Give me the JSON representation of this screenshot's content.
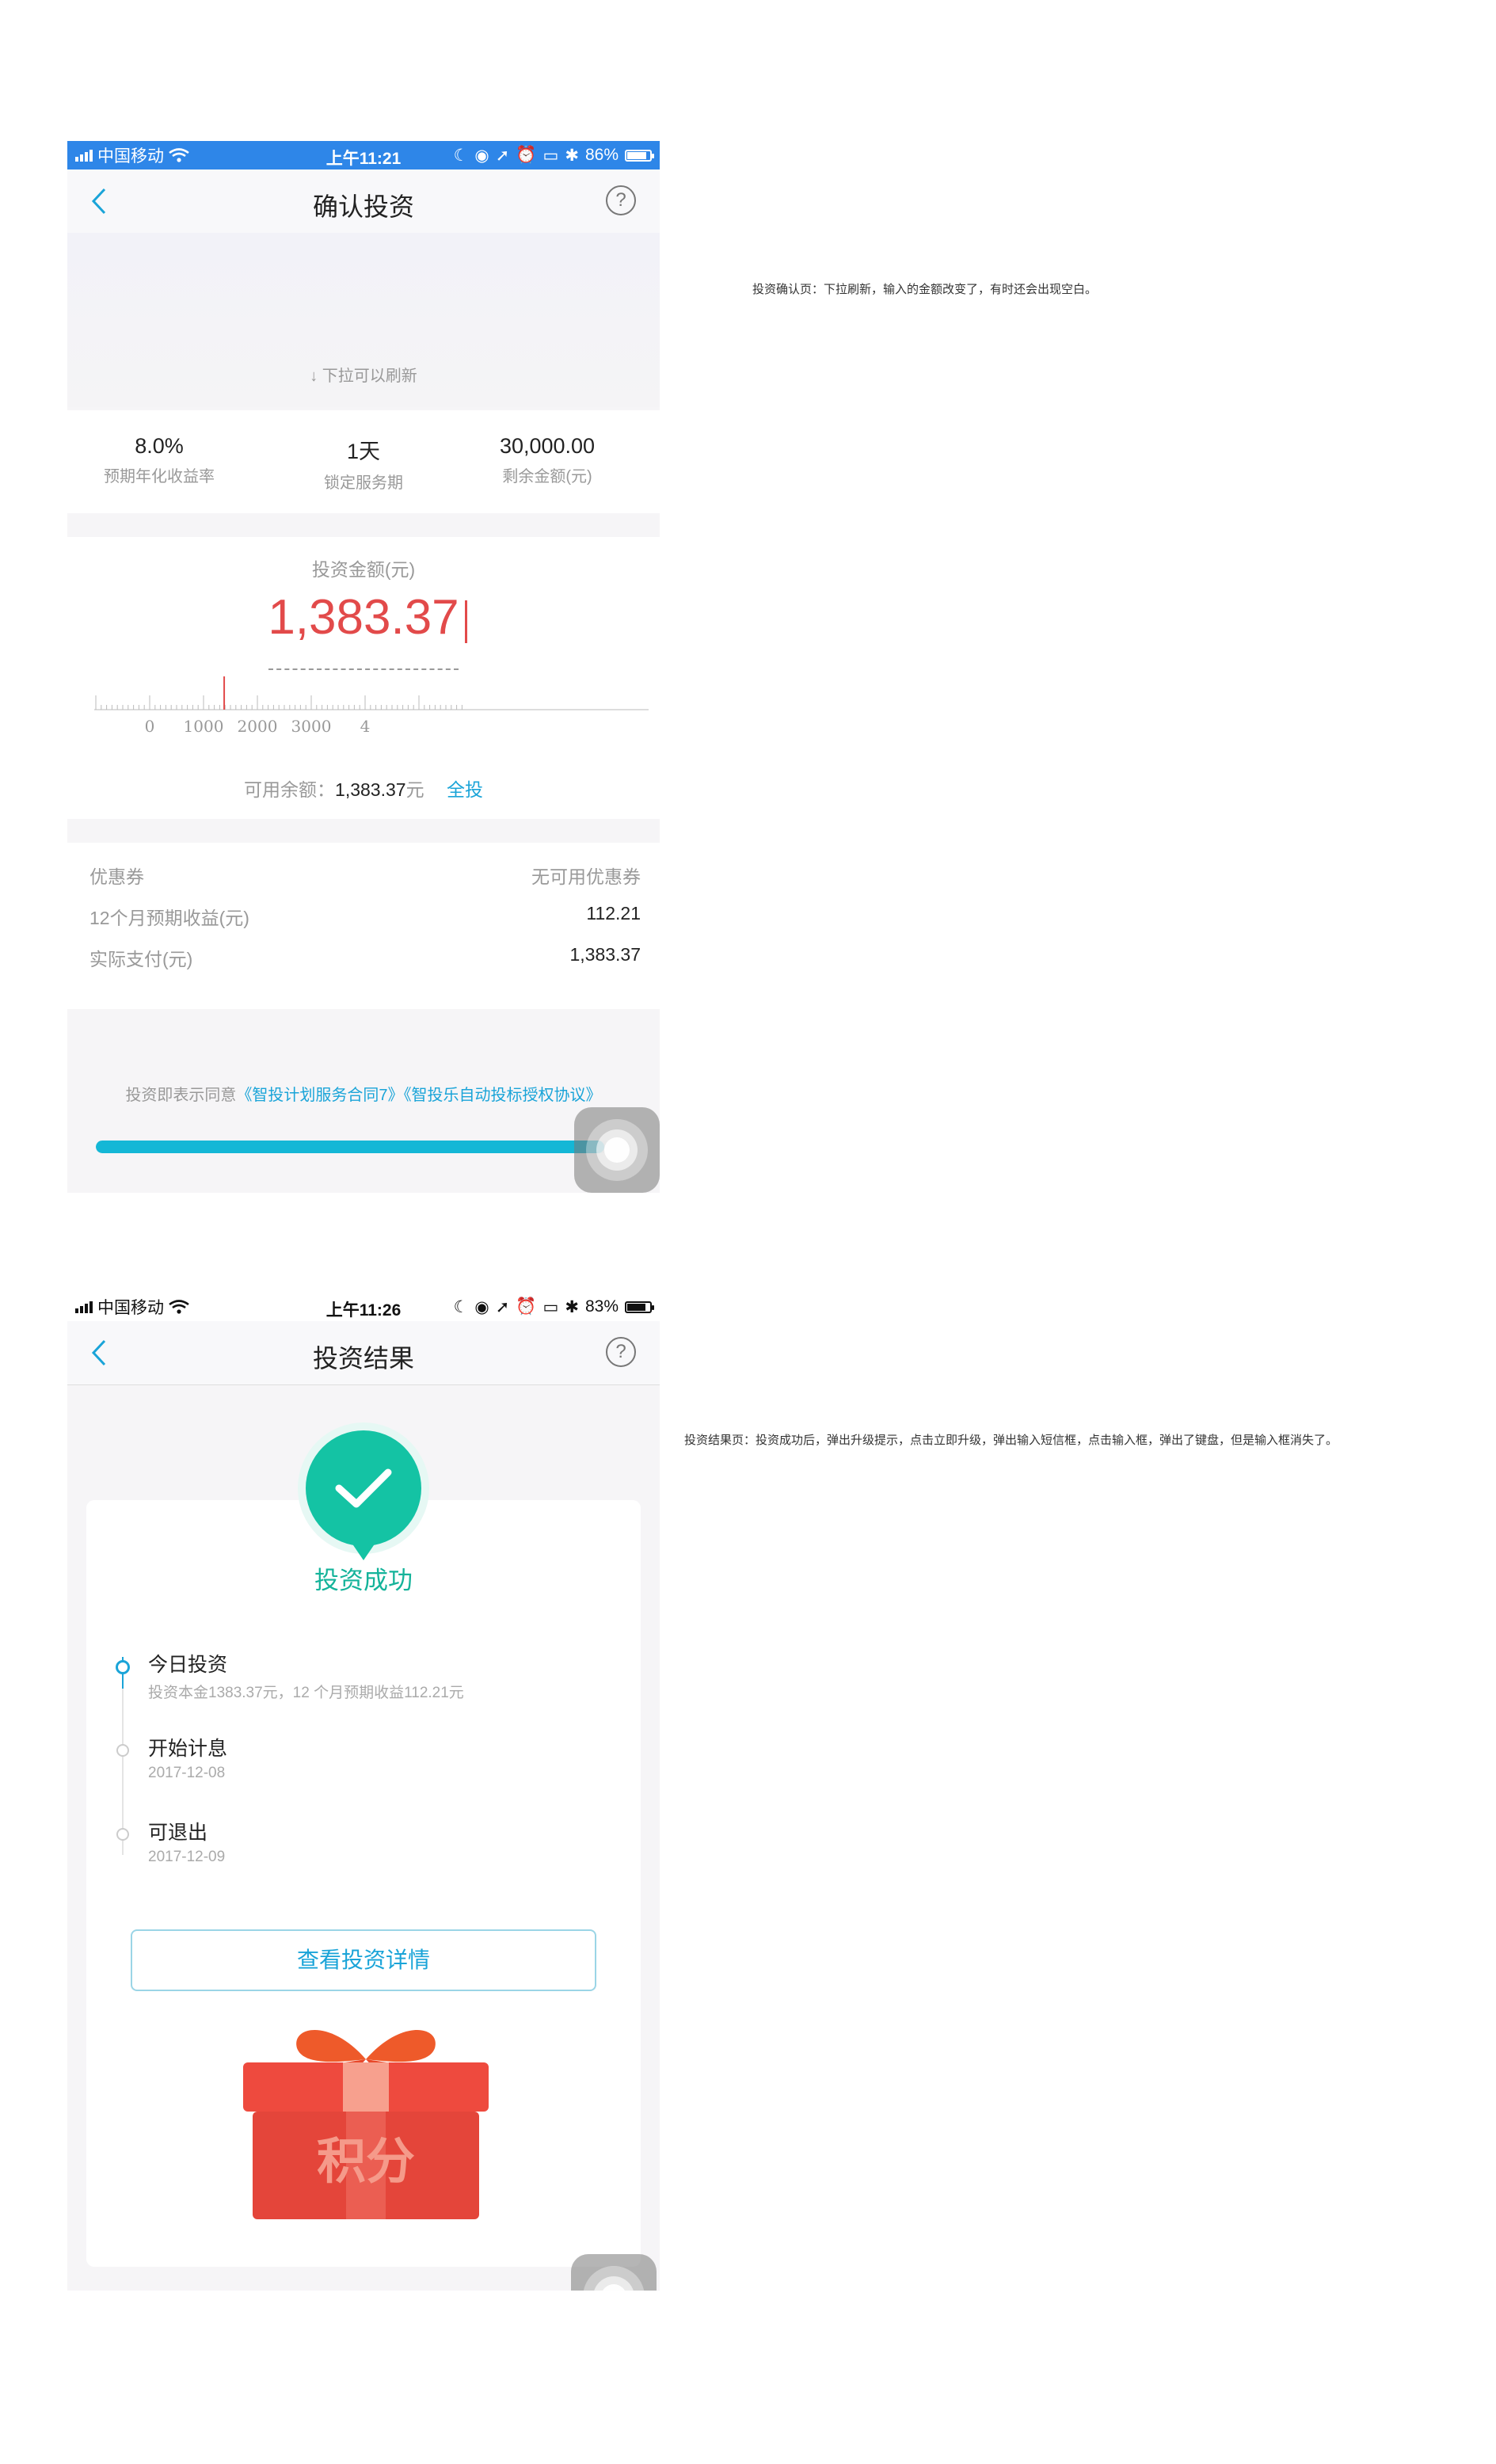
{
  "colors": {
    "status_bar_blue": "#2e86e8",
    "accent_red": "#e24a4a",
    "link_blue": "#1aa4d8",
    "progress_fill": "#14b7d6",
    "success_green": "#14c3a4",
    "gift_red": "#ee4a3e"
  },
  "screen1": {
    "status": {
      "carrier": "中国移动",
      "time": "上午11:21",
      "battery": "86%",
      "battery_level": 0.86
    },
    "nav": {
      "title": "确认投资",
      "help": "?"
    },
    "refresh_hint": "下拉可以刷新",
    "stats": [
      {
        "value": "8.0%",
        "label": "预期年化收益率"
      },
      {
        "value": "1天",
        "label": "锁定服务期"
      },
      {
        "value": "30,000.00",
        "label": "剩余金额(元)"
      }
    ],
    "invest": {
      "label": "投资金额(元)",
      "amount": "1,383.37",
      "ruler_ticks": [
        "0",
        "1000",
        "2000",
        "3000",
        "4"
      ],
      "ruler_value": 1383.37,
      "balance_label": "可用余额：",
      "balance_amount": "1,383.37",
      "balance_unit": "元",
      "all_in": "全投"
    },
    "rows": [
      {
        "key": "优惠券",
        "value": "无可用优惠券"
      },
      {
        "key": "12个月预期收益(元)",
        "value": "112.21"
      },
      {
        "key": "实际支付(元)",
        "value": "1,383.37"
      }
    ],
    "agreement": {
      "prefix": "投资即表示同意",
      "link1": "《智投计划服务合同7》",
      "link2": "《智投乐自动投标授权协议》"
    },
    "progress": 0.95
  },
  "screen2": {
    "status": {
      "carrier": "中国移动",
      "time": "上午11:26",
      "battery": "83%",
      "battery_level": 0.83
    },
    "nav": {
      "title": "投资结果",
      "help": "?"
    },
    "success_text": "投资成功",
    "timeline": [
      {
        "title": "今日投资",
        "desc": "投资本金1383.37元，12 个月预期收益112.21元"
      },
      {
        "title": "开始计息",
        "desc": "2017-12-08"
      },
      {
        "title": "可退出",
        "desc": "2017-12-09"
      }
    ],
    "detail_button": "查看投资详情",
    "gift_text": "积分"
  },
  "notes": {
    "note1": "投资确认页：下拉刷新，输入的金额改变了，有时还会出现空白。",
    "note2": "投资结果页：投资成功后，弹出升级提示，点击立即升级，弹出输入短信框，点击输入框，弹出了键盘，但是输入框消失了。"
  }
}
